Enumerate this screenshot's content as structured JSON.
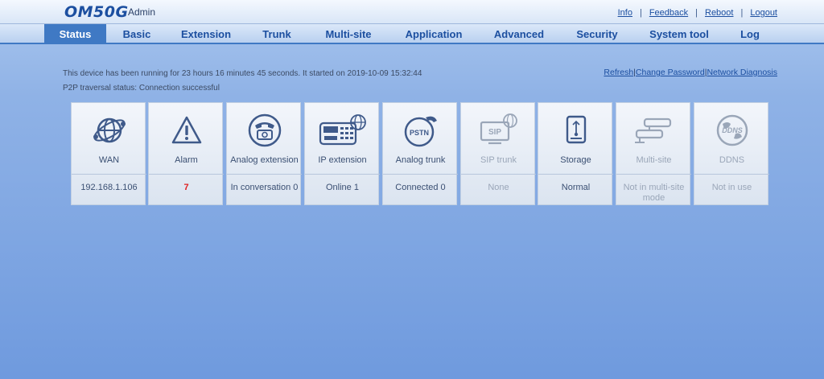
{
  "header": {
    "logo": "OM50G",
    "user": "Admin",
    "links": [
      "Info",
      "Feedback",
      "Reboot",
      "Logout"
    ]
  },
  "nav": {
    "items": [
      "Status",
      "Basic",
      "Extension",
      "Trunk",
      "Multi-site",
      "Application",
      "Advanced",
      "Security",
      "System tool",
      "Log"
    ],
    "active": "Status"
  },
  "status": {
    "running": "This device has been running for 23 hours 16 minutes 45 seconds. It started on 2019-10-09 15:32:44",
    "p2p": "P2P traversal status: Connection successful",
    "refresh": "Refresh",
    "change_password": "Change Password",
    "network_diagnosis": "Network Diagnosis",
    "separator": "|"
  },
  "tiles": [
    {
      "name": "WAN",
      "value": "192.168.1.106",
      "icon": "globe-icon"
    },
    {
      "name": "Alarm",
      "value": "7",
      "icon": "warning-icon"
    },
    {
      "name": "Analog extension",
      "value": "In conversation 0",
      "icon": "telephone-icon"
    },
    {
      "name": "IP extension",
      "value": "Online 1",
      "icon": "ip-phone-icon"
    },
    {
      "name": "Analog trunk",
      "value": "Connected 0",
      "icon": "pstn-icon"
    },
    {
      "name": "SIP trunk",
      "value": "None",
      "icon": "sip-icon"
    },
    {
      "name": "Storage",
      "value": "Normal",
      "icon": "storage-icon"
    },
    {
      "name": "Multi-site",
      "value": "Not in multi-site mode",
      "icon": "multisite-icon"
    },
    {
      "name": "DDNS",
      "value": "Not in use",
      "icon": "ddns-icon"
    }
  ],
  "colors": {
    "accent": "#3f79c4",
    "alert": "#e02020"
  }
}
